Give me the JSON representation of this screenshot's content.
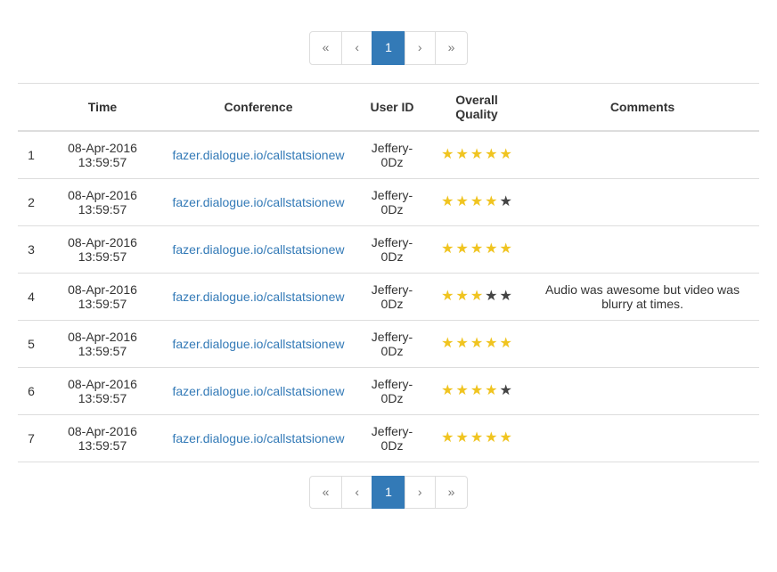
{
  "pagination": {
    "first": "«",
    "prev": "‹",
    "page": "1",
    "next": "›",
    "last": "»"
  },
  "table": {
    "headers": {
      "index": "",
      "time": "Time",
      "conference": "Conference",
      "user_id": "User ID",
      "overall_quality": "Overall Quality",
      "comments": "Comments"
    },
    "rows": [
      {
        "index": "1",
        "time": "08-Apr-2016 13:59:57",
        "conference": "fazer.dialogue.io/callstatsionew",
        "user_id": "Jeffery-0Dz",
        "rating": 5,
        "comment": ""
      },
      {
        "index": "2",
        "time": "08-Apr-2016 13:59:57",
        "conference": "fazer.dialogue.io/callstatsionew",
        "user_id": "Jeffery-0Dz",
        "rating": 4,
        "comment": ""
      },
      {
        "index": "3",
        "time": "08-Apr-2016 13:59:57",
        "conference": "fazer.dialogue.io/callstatsionew",
        "user_id": "Jeffery-0Dz",
        "rating": 5,
        "comment": ""
      },
      {
        "index": "4",
        "time": "08-Apr-2016 13:59:57",
        "conference": "fazer.dialogue.io/callstatsionew",
        "user_id": "Jeffery-0Dz",
        "rating": 3,
        "comment": "Audio was awesome but video was blurry at times."
      },
      {
        "index": "5",
        "time": "08-Apr-2016 13:59:57",
        "conference": "fazer.dialogue.io/callstatsionew",
        "user_id": "Jeffery-0Dz",
        "rating": 5,
        "comment": ""
      },
      {
        "index": "6",
        "time": "08-Apr-2016 13:59:57",
        "conference": "fazer.dialogue.io/callstatsionew",
        "user_id": "Jeffery-0Dz",
        "rating": 4,
        "comment": ""
      },
      {
        "index": "7",
        "time": "08-Apr-2016 13:59:57",
        "conference": "fazer.dialogue.io/callstatsionew",
        "user_id": "Jeffery-0Dz",
        "rating": 5,
        "comment": ""
      }
    ]
  }
}
